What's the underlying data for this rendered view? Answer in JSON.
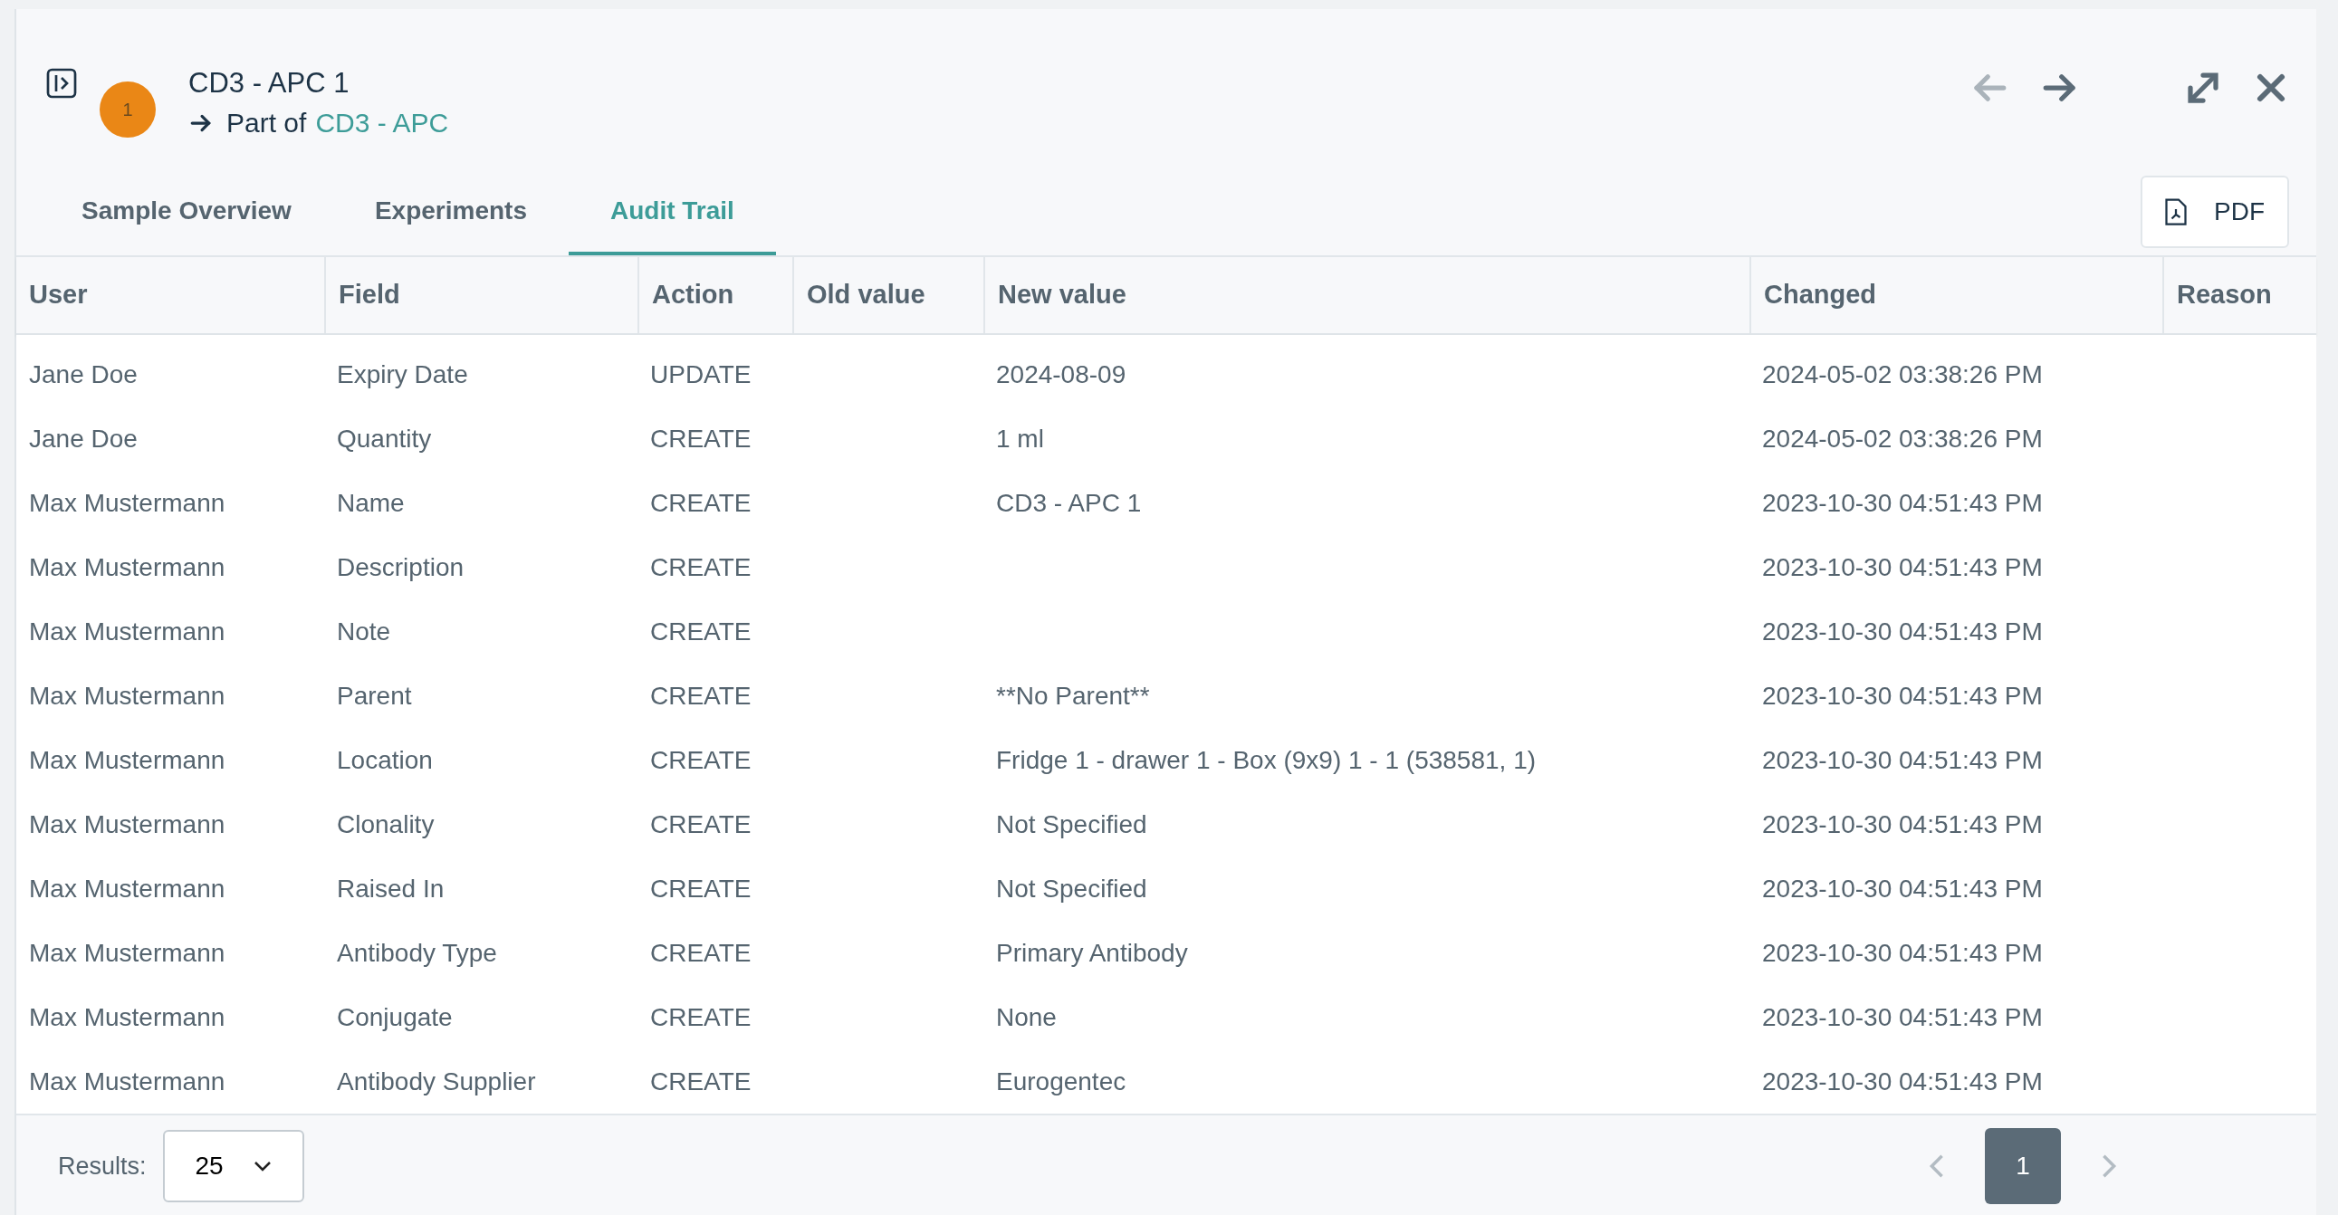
{
  "header": {
    "badge": "1",
    "title": "CD3 - APC 1",
    "part_of_label": "Part of",
    "parent_link": "CD3 - APC"
  },
  "nav": {
    "back_disabled": true,
    "forward_disabled": false
  },
  "tabs": [
    {
      "label": "Sample Overview",
      "selected": false
    },
    {
      "label": "Experiments",
      "selected": false
    },
    {
      "label": "Audit Trail",
      "selected": true
    }
  ],
  "pdf_button": "PDF",
  "table": {
    "columns": [
      "User",
      "Field",
      "Action",
      "Old value",
      "New value",
      "Changed",
      "Reason"
    ],
    "rows": [
      {
        "user": "Jane Doe",
        "field": "Expiry Date",
        "action": "UPDATE",
        "new_value": "2024-08-09",
        "changed": "2024-05-02 03:38:26 PM"
      },
      {
        "user": "Jane Doe",
        "field": "Quantity",
        "action": "CREATE",
        "new_value": "1 ml",
        "changed": "2024-05-02 03:38:26 PM"
      },
      {
        "user": "Max Mustermann",
        "field": "Name",
        "action": "CREATE",
        "new_value": "CD3 - APC 1",
        "changed": "2023-10-30 04:51:43 PM"
      },
      {
        "user": "Max Mustermann",
        "field": "Description",
        "action": "CREATE",
        "changed": "2023-10-30 04:51:43 PM"
      },
      {
        "user": "Max Mustermann",
        "field": "Note",
        "action": "CREATE",
        "changed": "2023-10-30 04:51:43 PM"
      },
      {
        "user": "Max Mustermann",
        "field": "Parent",
        "action": "CREATE",
        "new_value": "**No Parent**",
        "changed": "2023-10-30 04:51:43 PM"
      },
      {
        "user": "Max Mustermann",
        "field": "Location",
        "action": "CREATE",
        "new_value": "Fridge 1 - drawer 1 - Box (9x9) 1 - 1 (538581, 1)",
        "changed": "2023-10-30 04:51:43 PM"
      },
      {
        "user": "Max Mustermann",
        "field": "Clonality",
        "action": "CREATE",
        "new_value": "Not Specified",
        "changed": "2023-10-30 04:51:43 PM"
      },
      {
        "user": "Max Mustermann",
        "field": "Raised In",
        "action": "CREATE",
        "new_value": "Not Specified",
        "changed": "2023-10-30 04:51:43 PM"
      },
      {
        "user": "Max Mustermann",
        "field": "Antibody Type",
        "action": "CREATE",
        "new_value": "Primary Antibody",
        "changed": "2023-10-30 04:51:43 PM"
      },
      {
        "user": "Max Mustermann",
        "field": "Conjugate",
        "action": "CREATE",
        "new_value": "None",
        "changed": "2023-10-30 04:51:43 PM"
      },
      {
        "user": "Max Mustermann",
        "field": "Antibody Supplier",
        "action": "CREATE",
        "new_value": "Eurogentec",
        "changed": "2023-10-30 04:51:43 PM"
      }
    ]
  },
  "footer": {
    "results_label": "Results:",
    "page_size": "25",
    "pages": [
      {
        "label": "1",
        "selected": true
      }
    ]
  }
}
